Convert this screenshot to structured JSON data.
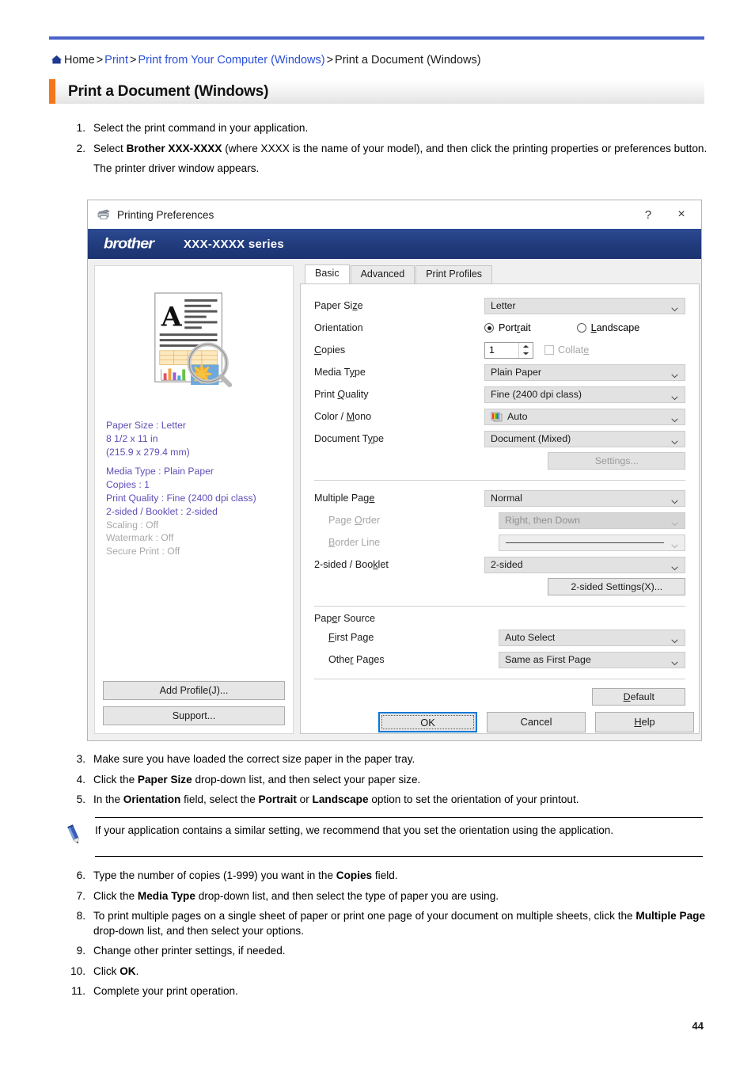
{
  "breadcrumb": {
    "home_icon": "home-icon",
    "items": [
      {
        "label": "Home",
        "link": false
      },
      {
        "label": "Print",
        "link": true
      },
      {
        "label": "Print from Your Computer (Windows)",
        "link": true
      },
      {
        "label": "Print a Document (Windows)",
        "link": false
      }
    ],
    "separator": ">"
  },
  "heading": {
    "title": "Print a Document (Windows)",
    "accent_color": "#f4761b"
  },
  "colors": {
    "top_rule": "#4a62c8",
    "link": "#2b4fd8",
    "brand_bar": "#243f80",
    "preview_text": "#5d4fb8",
    "preview_dim": "#a9a9a9",
    "focus_border": "#0078d7"
  },
  "steps_before": [
    {
      "num": "1.",
      "text": "Select the print command in your application."
    },
    {
      "num": "2.",
      "text": "Select <b>Brother XXX-XXXX</b> (where XXXX is the name of your model), and then click the printing properties or preferences button.",
      "sub": "The printer driver window appears."
    }
  ],
  "steps_middle": [
    {
      "num": "3.",
      "text": "Make sure you have loaded the correct size paper in the paper tray."
    },
    {
      "num": "4.",
      "text": "Click the <b>Paper Size</b> drop-down list, and then select your paper size."
    },
    {
      "num": "5.",
      "text": "In the <b>Orientation</b> field, select the <b>Portrait</b> or <b>Landscape</b> option to set the orientation of your printout."
    }
  ],
  "note": {
    "icon": "pencil-note-icon",
    "text": "If your application contains a similar setting, we recommend that you set the orientation using the application."
  },
  "steps_after": [
    {
      "num": "6.",
      "text": "Type the number of copies (1-999) you want in the <b>Copies</b> field."
    },
    {
      "num": "7.",
      "text": "Click the <b>Media Type</b> drop-down list, and then select the type of paper you are using."
    },
    {
      "num": "8.",
      "text": "To print multiple pages on a single sheet of paper or print one page of your document on multiple sheets, click the <b>Multiple Page</b> drop-down list, and then select your options."
    },
    {
      "num": "9.",
      "text": "Change other printer settings, if needed."
    },
    {
      "num": "10.",
      "text": "Click <b>OK</b>."
    },
    {
      "num": "11.",
      "text": "Complete your print operation."
    }
  ],
  "dialog": {
    "titlebar": {
      "icon": "printer-icon",
      "title": "Printing Preferences",
      "help_button": "?",
      "close_button": "×"
    },
    "brand": {
      "logo": "brother",
      "model": "XXX-XXXX series"
    },
    "preview": {
      "thumbnail_icon": "document-preview-icon",
      "info": [
        {
          "text": "Paper Size : Letter",
          "dim": false
        },
        {
          "text": "8 1/2 x 11 in",
          "dim": false
        },
        {
          "text": "(215.9 x 279.4 mm)",
          "dim": false
        },
        {
          "text": "Media Type : Plain Paper",
          "dim": false
        },
        {
          "text": "Copies : 1",
          "dim": false
        },
        {
          "text": "Print Quality : Fine (2400 dpi class)",
          "dim": false
        },
        {
          "text": "2-sided / Booklet : 2-sided",
          "dim": false
        },
        {
          "text": "Scaling : Off",
          "dim": true
        },
        {
          "text": "Watermark : Off",
          "dim": true
        },
        {
          "text": "Secure Print : Off",
          "dim": true
        }
      ],
      "add_profile_button": "Add Profile(J)...",
      "support_button": "Support..."
    },
    "tabs": [
      {
        "label": "Basic",
        "active": true
      },
      {
        "label": "Advanced",
        "active": false
      },
      {
        "label": "Print Profiles",
        "active": false
      }
    ],
    "fields": {
      "paper_size": {
        "label": "Paper Size",
        "value": "Letter"
      },
      "orientation": {
        "label": "Orientation",
        "portrait": "Portrait",
        "landscape": "Landscape",
        "selected": "Portrait"
      },
      "copies": {
        "label": "Copies",
        "value": "1",
        "collate_label": "Collate",
        "collate_checked": false,
        "collate_enabled": false
      },
      "media_type": {
        "label": "Media Type",
        "value": "Plain Paper"
      },
      "print_quality": {
        "label": "Print Quality",
        "value": "Fine (2400 dpi class)"
      },
      "color_mono": {
        "label": "Color / Mono",
        "value": "Auto",
        "icon": "color-swatch-icon"
      },
      "document_type": {
        "label": "Document Type",
        "value": "Document (Mixed)"
      },
      "settings_button": "Settings...",
      "multiple_page": {
        "label": "Multiple Page",
        "value": "Normal"
      },
      "page_order": {
        "label": "Page Order",
        "value": "Right, then Down",
        "enabled": false
      },
      "border_line": {
        "label": "Border Line",
        "value": "",
        "enabled": false
      },
      "two_sided_booklet": {
        "label": "2-sided / Booklet",
        "value": "2-sided"
      },
      "two_sided_settings_button": "2-sided Settings(X)...",
      "paper_source": {
        "label": "Paper Source"
      },
      "first_page": {
        "label": "First Page",
        "value": "Auto Select"
      },
      "other_pages": {
        "label": "Other Pages",
        "value": "Same as First Page"
      },
      "default_button": "Default"
    },
    "footer": {
      "ok": "OK",
      "cancel": "Cancel",
      "help": "Help"
    }
  },
  "page_number": "44"
}
